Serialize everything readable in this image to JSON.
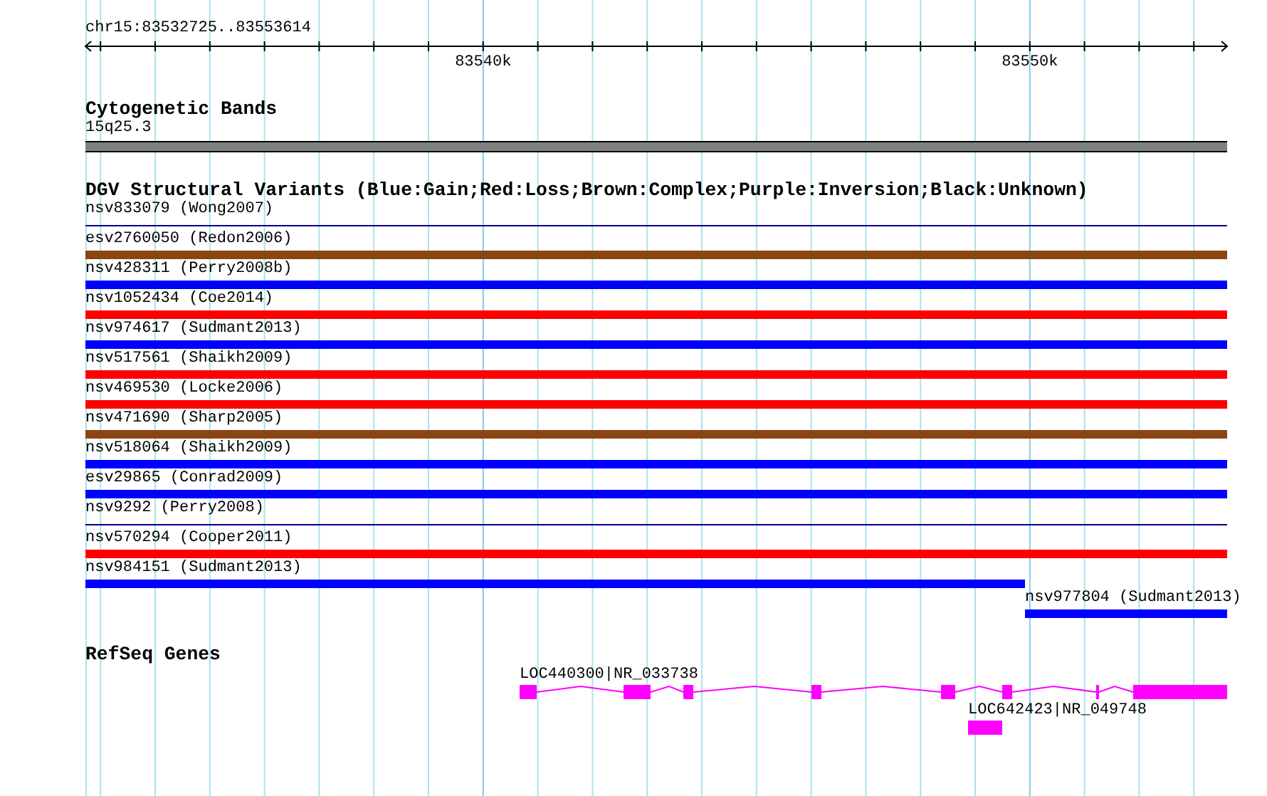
{
  "ruler": {
    "range": "chr15:83532725..83553614",
    "tick_labels": [
      "83540k",
      "83550k"
    ]
  },
  "cytogenetic_bands": {
    "title": "Cytogenetic Bands",
    "band": "15q25.3"
  },
  "dgv": {
    "title": "DGV Structural Variants (Blue:Gain;Red:Loss;Brown:Complex;Purple:Inversion;Black:Unknown)",
    "variants": [
      {
        "label": "nsv833079 (Wong2007)",
        "kind": "line",
        "color": "#00008b"
      },
      {
        "label": "esv2760050 (Redon2006)",
        "kind": "bar",
        "color": "#8b4513"
      },
      {
        "label": "nsv428311 (Perry2008b)",
        "kind": "bar",
        "color": "#0000ff"
      },
      {
        "label": "nsv1052434 (Coe2014)",
        "kind": "bar",
        "color": "#ff0000"
      },
      {
        "label": "nsv974617 (Sudmant2013)",
        "kind": "bar",
        "color": "#0000ff"
      },
      {
        "label": "nsv517561 (Shaikh2009)",
        "kind": "bar",
        "color": "#ff0000"
      },
      {
        "label": "nsv469530 (Locke2006)",
        "kind": "bar",
        "color": "#ff0000"
      },
      {
        "label": "nsv471690 (Sharp2005)",
        "kind": "bar",
        "color": "#8b4513"
      },
      {
        "label": "nsv518064 (Shaikh2009)",
        "kind": "bar",
        "color": "#0000ff"
      },
      {
        "label": "esv29865 (Conrad2009)",
        "kind": "bar",
        "color": "#0000ff"
      },
      {
        "label": "nsv9292 (Perry2008)",
        "kind": "line",
        "color": "#00008b"
      },
      {
        "label": "nsv570294 (Cooper2011)",
        "kind": "bar",
        "color": "#ff0000"
      },
      {
        "label": "nsv984151 (Sudmant2013)",
        "kind": "leftbar",
        "color": "#0000ff"
      },
      {
        "label": "nsv977804 (Sudmant2013)",
        "kind": "rightbar",
        "color": "#0000ff"
      }
    ]
  },
  "refseq": {
    "title": "RefSeq Genes",
    "genes": [
      {
        "label": "LOC440300|NR_033738"
      },
      {
        "label": "LOC642423|NR_049748"
      }
    ]
  }
}
